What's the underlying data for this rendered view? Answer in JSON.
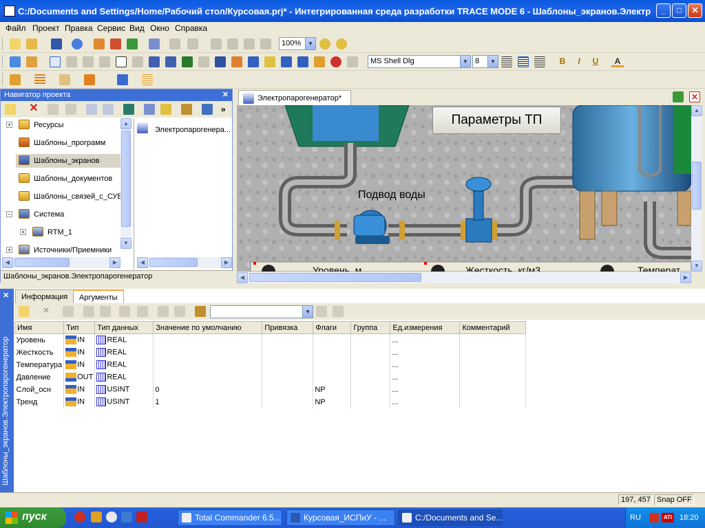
{
  "window": {
    "title": "C:/Documents and Settings/Home/Рабочий стол/Курсовая.prj* - Интегрированная среда разработки TRACE MODE 6 - Шаблоны_экранов.Электр...",
    "min": "_",
    "max": "□",
    "close": "✕"
  },
  "menu": [
    "Файл",
    "Проект",
    "Правка",
    "Сервис",
    "Вид",
    "Окно",
    "Справка"
  ],
  "toolbar": {
    "zoom": "100%",
    "font": "MS Shell Dlg",
    "font_size": "8",
    "bold": "B",
    "italic": "I",
    "underline": "U",
    "font_color": "A"
  },
  "navigator": {
    "title": "Навигатор проекта",
    "close": "✕",
    "tree": [
      {
        "label": "Ресурсы",
        "expander": "+"
      },
      {
        "label": "Шаблоны_программ"
      },
      {
        "label": "Шаблоны_экранов",
        "selected": true
      },
      {
        "label": "Шаблоны_документов"
      },
      {
        "label": "Шаблоны_связей_с_СУБ"
      },
      {
        "label": "Система",
        "expander": "−"
      },
      {
        "label": "RTM_1",
        "expander": "+"
      },
      {
        "label": "Источники/Приемники",
        "expander": "+"
      }
    ],
    "right_item": "Электропарогенера...",
    "status": "Шаблоны_экранов.Электропарогенератор"
  },
  "editor": {
    "tab": "Электропарогенератор*",
    "button_params": "Параметры ТП",
    "label_water": "Подвод воды",
    "bottom_labels": [
      "Уровень, м",
      "Жесткость, кг/м3",
      "Температ..."
    ]
  },
  "sidebar_title": "Шаблоны_экранов.Электропарогенератор",
  "bottom_tabs": [
    "Информация",
    "Аргументы"
  ],
  "args": {
    "columns": [
      "Имя",
      "Тип",
      "Тип данных",
      "Значение по умолчанию",
      "Привязка",
      "Флаги",
      "Группа",
      "Ед.измерения",
      "Комментарий"
    ],
    "rows": [
      {
        "name": "Уровень",
        "type": "IN",
        "dtype": "REAL",
        "default": "",
        "bind": "",
        "flags": "",
        "group": "",
        "unit": "...",
        "comment": ""
      },
      {
        "name": "Жесткость",
        "type": "IN",
        "dtype": "REAL",
        "default": "",
        "bind": "",
        "flags": "",
        "group": "",
        "unit": "...",
        "comment": ""
      },
      {
        "name": "Температура",
        "type": "IN",
        "dtype": "REAL",
        "default": "",
        "bind": "",
        "flags": "",
        "group": "",
        "unit": "...",
        "comment": ""
      },
      {
        "name": "Давление",
        "type": "OUT",
        "dtype": "REAL",
        "default": "",
        "bind": "",
        "flags": "",
        "group": "",
        "unit": "...",
        "comment": ""
      },
      {
        "name": "Слой_осн",
        "type": "IN",
        "dtype": "USINT",
        "default": "0",
        "bind": "",
        "flags": "NP",
        "group": "",
        "unit": "...",
        "comment": ""
      },
      {
        "name": "Тренд",
        "type": "IN",
        "dtype": "USINT",
        "default": "1",
        "bind": "",
        "flags": "NP",
        "group": "",
        "unit": "...",
        "comment": ""
      }
    ]
  },
  "status": {
    "coords": "197, 457",
    "snap": "Snap OFF"
  },
  "taskbar": {
    "start": "пуск",
    "tasks": [
      "Total Commander 6.5...",
      "Курсовая_ИСПиУ - ...",
      "C:/Documents and Se..."
    ],
    "lang": "RU",
    "clock": "18:20"
  }
}
